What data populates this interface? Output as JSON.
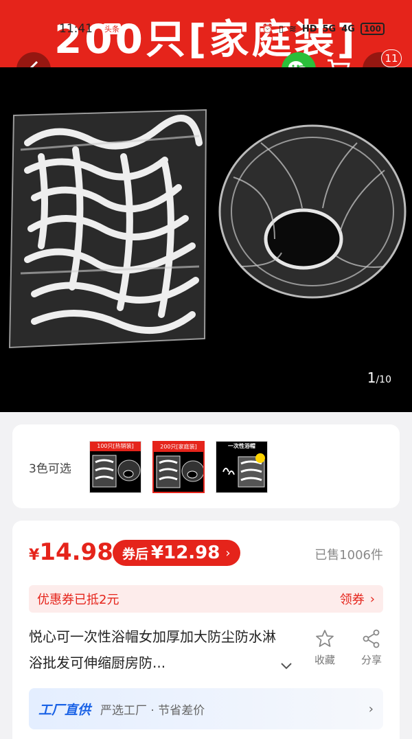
{
  "status": {
    "time": "11:41",
    "app": "头条",
    "icons": [
      "HD",
      "5G",
      "4G"
    ],
    "battery": "100"
  },
  "hero": {
    "banner_text": "200只[家庭装]",
    "cart_badge": "11",
    "page_current": "1",
    "page_total": "/10"
  },
  "variants": {
    "label": "3色可选",
    "thumbs": [
      "100只[热销装]",
      "200只[家庭装]",
      "一次性浴帽"
    ]
  },
  "price": {
    "currency": "¥",
    "value": "14.98",
    "coupon_label": "券后",
    "coupon_value": "¥12.98",
    "sold": "已售1006件"
  },
  "discount": {
    "text": "优惠券已抵2元",
    "action": "领券"
  },
  "product": {
    "title": "悦心可一次性浴帽女加厚加大防尘防水淋浴批发可伸缩厨房防...",
    "favorite_label": "收藏",
    "share_label": "分享"
  },
  "factory": {
    "tag": "工厂直供",
    "desc": "严选工厂 · 节省差价"
  },
  "colors": {
    "accent": "#e5241b",
    "factory_blue": "#1a62e6"
  }
}
